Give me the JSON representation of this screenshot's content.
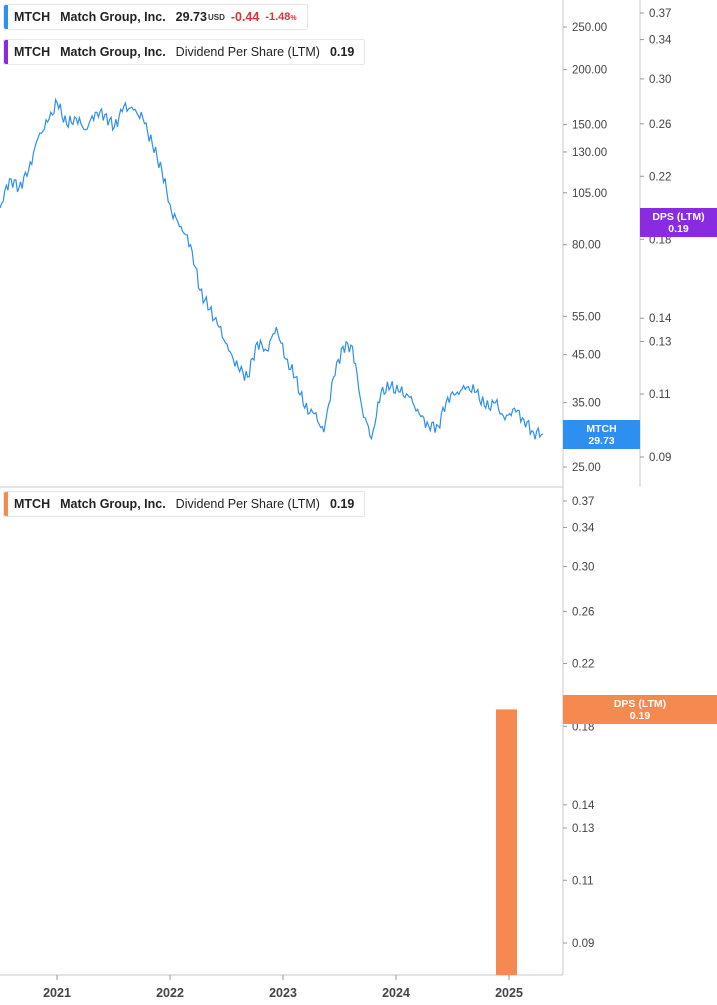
{
  "legends": {
    "price": {
      "ticker": "MTCH",
      "company": "Match Group, Inc.",
      "price": "29.73",
      "currency": "USD",
      "change": "-0.44",
      "change_pct": "-1.48",
      "pct_symbol": "%",
      "color": "#2d8ff0"
    },
    "dps_top": {
      "ticker": "MTCH",
      "company": "Match Group, Inc.",
      "metric": "Dividend Per Share (LTM)",
      "value": "0.19",
      "color": "#8a2be2"
    },
    "dps_bottom": {
      "ticker": "MTCH",
      "company": "Match Group, Inc.",
      "metric": "Dividend Per Share (LTM)",
      "value": "0.19",
      "color": "#f5894f"
    }
  },
  "tags": {
    "price": {
      "label": "MTCH",
      "value": "29.73",
      "color": "#2d8ff0"
    },
    "dps_top": {
      "label": "DPS (LTM)",
      "value": "0.19",
      "color": "#8a2be2"
    },
    "dps_bottom": {
      "label": "DPS (LTM)",
      "value": "0.19",
      "color": "#f5894f"
    }
  },
  "chart_data": [
    {
      "type": "line",
      "scale": "log",
      "series": [
        {
          "color": "#2d8ff0",
          "x": [
            "2020-08",
            "2020-09",
            "2020-10",
            "2020-11",
            "2020-12",
            "2021-01",
            "2021-02",
            "2021-03",
            "2021-04",
            "2021-05",
            "2021-06",
            "2021-07",
            "2021-08",
            "2021-09",
            "2021-10",
            "2021-11",
            "2021-12",
            "2022-01",
            "2022-02",
            "2022-03",
            "2022-04",
            "2022-05",
            "2022-06",
            "2022-07",
            "2022-08",
            "2022-09",
            "2022-10",
            "2022-11",
            "2022-12",
            "2023-01",
            "2023-02",
            "2023-03",
            "2023-04",
            "2023-05",
            "2023-06",
            "2023-07",
            "2023-08",
            "2023-09",
            "2023-10",
            "2023-11",
            "2023-12",
            "2024-01",
            "2024-02",
            "2024-03",
            "2024-04",
            "2024-05",
            "2024-06",
            "2024-07",
            "2024-08",
            "2024-09",
            "2024-10",
            "2024-11",
            "2024-12",
            "2025-01",
            "2025-02",
            "2025-03",
            "2025-04",
            "2025-05"
          ],
          "y": [
            97,
            113,
            108,
            118,
            140,
            152,
            168,
            150,
            155,
            146,
            160,
            158,
            148,
            165,
            162,
            155,
            135,
            118,
            95,
            88,
            80,
            63,
            57,
            52,
            46,
            42,
            40,
            48,
            46,
            52,
            44,
            40,
            34,
            33,
            30,
            40,
            47,
            47,
            34,
            29,
            37,
            38,
            37,
            36,
            33,
            31,
            31,
            36,
            37,
            38,
            37,
            34,
            35,
            32,
            34,
            32,
            30,
            29.73
          ]
        }
      ],
      "y_ticks": [
        25,
        35,
        45,
        55,
        80,
        105,
        130,
        150,
        200,
        250
      ],
      "y2_ticks": [
        0.09,
        0.11,
        0.13,
        0.14,
        0.18,
        0.22,
        0.26,
        0.3,
        0.34,
        0.37
      ]
    },
    {
      "type": "bar",
      "series": [
        {
          "color": "#f5894f",
          "x": [
            "2025-01"
          ],
          "values": [
            0.19
          ]
        }
      ],
      "y_ticks": [
        0.09,
        0.11,
        0.13,
        0.14,
        0.18,
        0.22,
        0.26,
        0.3,
        0.34,
        0.37
      ]
    }
  ],
  "x_ticks": [
    "2021",
    "2022",
    "2023",
    "2024",
    "2025"
  ]
}
